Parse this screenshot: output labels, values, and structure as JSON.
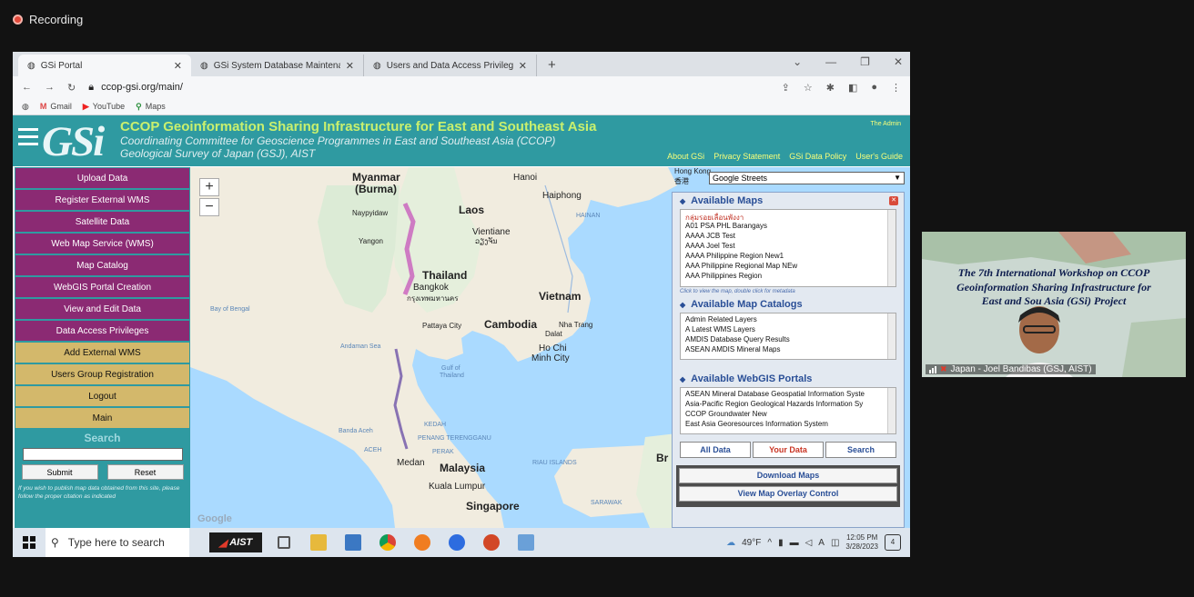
{
  "recording": {
    "label": "Recording"
  },
  "browser": {
    "tabs": [
      {
        "label": "GSi Portal",
        "active": true
      },
      {
        "label": "GSi System Database Maintenan",
        "active": false
      },
      {
        "label": "Users and Data Access Privileges",
        "active": false
      }
    ],
    "new_tab": "+",
    "url": "ccop-gsi.org/main/",
    "bookmarks": [
      "Gmail",
      "YouTube",
      "Maps"
    ]
  },
  "banner": {
    "logo": "GSi",
    "title": "CCOP Geoinformation Sharing Infrastructure for East and Southeast Asia",
    "subtitle1": "Coordinating Committee for Geoscience Programmes in East and Southeast Asia (CCOP)",
    "subtitle2": "Geological Survey of Japan (GSJ), AIST",
    "admin": "The Admin",
    "nav": [
      "About GSi",
      "Privacy Statement",
      "GSi Data Policy",
      "User's Guide"
    ]
  },
  "sidebar": {
    "items": [
      {
        "label": "Upload Data",
        "style": "p"
      },
      {
        "label": "Register External WMS",
        "style": "p"
      },
      {
        "label": "Satellite Data",
        "style": "p"
      },
      {
        "label": "Web Map Service (WMS)",
        "style": "p"
      },
      {
        "label": "Map Catalog",
        "style": "p"
      },
      {
        "label": "WebGIS Portal Creation",
        "style": "p"
      },
      {
        "label": "View and Edit Data",
        "style": "p"
      },
      {
        "label": "Data Access Privileges",
        "style": "p"
      },
      {
        "label": "Add External WMS",
        "style": "y"
      },
      {
        "label": "Users Group Registration",
        "style": "y"
      },
      {
        "label": "Logout",
        "style": "y"
      },
      {
        "label": "Main",
        "style": "y"
      }
    ],
    "search_title": "Search",
    "submit_label": "Submit",
    "reset_label": "Reset",
    "note": "If you wish to publish map data obtained from this site, please follow the proper citation as indicated"
  },
  "map": {
    "zoom_in": "+",
    "zoom_out": "−",
    "attribution": "Google",
    "labels": [
      {
        "text": "Myanmar",
        "cls": "big",
        "l": 178,
        "t": 4
      },
      {
        "text": "(Burma)",
        "cls": "big",
        "l": 181,
        "t": 17
      },
      {
        "text": "Hanoi",
        "cls": "",
        "l": 355,
        "t": 6
      },
      {
        "text": "Haiphong",
        "cls": "",
        "l": 387,
        "t": 26
      },
      {
        "text": "Hong Kong",
        "cls": "sm",
        "l": 532,
        "t": 0
      },
      {
        "text": "香港",
        "cls": "sm",
        "l": 532,
        "t": 10
      },
      {
        "text": "Laos",
        "cls": "big",
        "l": 295,
        "t": 40
      },
      {
        "text": "HAINAN",
        "cls": "sea",
        "l": 424,
        "t": 50
      },
      {
        "text": "Naypyidaw",
        "cls": "sm",
        "l": 178,
        "t": 46
      },
      {
        "text": "Vientiane",
        "cls": "",
        "l": 310,
        "t": 66
      },
      {
        "text": "ວຽງຈັນ",
        "cls": "sm",
        "l": 313,
        "t": 77
      },
      {
        "text": "Yangon",
        "cls": "sm",
        "l": 185,
        "t": 77
      },
      {
        "text": "Thailand",
        "cls": "big",
        "l": 255,
        "t": 112
      },
      {
        "text": "Bangkok",
        "cls": "",
        "l": 245,
        "t": 127
      },
      {
        "text": "กรุงเทพมหานคร",
        "cls": "sm",
        "l": 238,
        "t": 138
      },
      {
        "text": "Vietnam",
        "cls": "big",
        "l": 383,
        "t": 135
      },
      {
        "text": "Bay of Bengal",
        "cls": "sea",
        "l": 22,
        "t": 153
      },
      {
        "text": "Cambodia",
        "cls": "big",
        "l": 323,
        "t": 166
      },
      {
        "text": "Pattaya City",
        "cls": "sm",
        "l": 255,
        "t": 170
      },
      {
        "text": "Nha Trang",
        "cls": "sm",
        "l": 405,
        "t": 169
      },
      {
        "text": "Dalat",
        "cls": "sm",
        "l": 390,
        "t": 179
      },
      {
        "text": "Andaman Sea",
        "cls": "sea",
        "l": 165,
        "t": 194
      },
      {
        "text": "Ho Chi",
        "cls": "",
        "l": 383,
        "t": 194
      },
      {
        "text": "Minh City",
        "cls": "",
        "l": 375,
        "t": 205
      },
      {
        "text": "Gulf of",
        "cls": "sea",
        "l": 276,
        "t": 218
      },
      {
        "text": "Thailand",
        "cls": "sea",
        "l": 274,
        "t": 226
      },
      {
        "text": "Banda Aceh",
        "cls": "sea",
        "l": 163,
        "t": 287
      },
      {
        "text": "KEDAH",
        "cls": "sea",
        "l": 257,
        "t": 280
      },
      {
        "text": "PENANG TERENGGANU",
        "cls": "sea",
        "l": 250,
        "t": 295
      },
      {
        "text": "ACEH",
        "cls": "sea",
        "l": 191,
        "t": 308
      },
      {
        "text": "PERAK",
        "cls": "sea",
        "l": 266,
        "t": 310
      },
      {
        "text": "Medan",
        "cls": "",
        "l": 227,
        "t": 320
      },
      {
        "text": "Malaysia",
        "cls": "big",
        "l": 274,
        "t": 324
      },
      {
        "text": "RIAU ISLANDS",
        "cls": "sea",
        "l": 376,
        "t": 322
      },
      {
        "text": "Kuala Lumpur",
        "cls": "",
        "l": 262,
        "t": 346
      },
      {
        "text": "Singapore",
        "cls": "big",
        "l": 303,
        "t": 366
      },
      {
        "text": "SARAWAK",
        "cls": "sea",
        "l": 440,
        "t": 366
      },
      {
        "text": "Br",
        "cls": "big",
        "l": 512,
        "t": 313
      }
    ]
  },
  "panel": {
    "base_layer": "Google Streets",
    "available_maps_title": "Available Maps",
    "available_maps": [
      "กลุ่มรอยเลื่อนพังงา",
      "A01 PSA PHL Barangays",
      "AAAA JCB Test",
      "AAAA Joel Test",
      "AAAA Philippine Region New1",
      "AAA Philippine Regional Map NEw",
      "AAA Philippines Region"
    ],
    "maps_hint": "Click to view the map, double click for metadata",
    "catalogs_title": "Available Map Catalogs",
    "catalogs": [
      "Admin Related Layers",
      "A Latest WMS Layers",
      "AMDIS Database Query Results",
      "ASEAN AMDIS Mineral Maps"
    ],
    "portals_title": "Available WebGIS Portals",
    "portals": [
      "ASEAN Mineral Database Geospatial Information Syste",
      "Asia-Pacific Region Geological Hazards Information Sy",
      "CCOP Groundwater New",
      "East Asia Georesources Information System"
    ],
    "tab_all": "All Data",
    "tab_yours": "Your Data",
    "tab_search": "Search",
    "download_maps": "Download Maps",
    "overlay_control": "View Map Overlay Control"
  },
  "taskbar": {
    "search_placeholder": "Type here to search",
    "aist_label": "AIST",
    "weather": "49°F",
    "lang": "A",
    "time": "12:05 PM",
    "date": "3/28/2023",
    "notifications": "4"
  },
  "video": {
    "title_line1": "The 7th International Workshop on CCOP",
    "title_line2": "Geoinformation Sharing Infrastructure for",
    "title_line3": "East and Sou    Asia (GSi) Project",
    "participant": "Japan - Joel Bandibas (GSJ, AIST)"
  },
  "colors": {
    "banner": "#2f9aa1",
    "sidebar_purple": "#8b2a73",
    "sidebar_yellow": "#d3b86b",
    "panel_heading": "#2a4f97"
  }
}
